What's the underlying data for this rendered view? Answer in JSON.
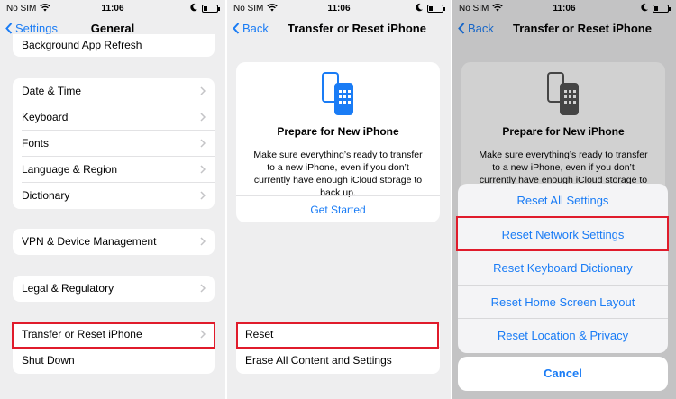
{
  "status": {
    "carrier": "No SIM",
    "time": "11:06"
  },
  "colors": {
    "accent": "#1a7cf5",
    "highlight": "#e01b2b",
    "background": "#eeeeef"
  },
  "panel1": {
    "back_label": "Settings",
    "title": "General",
    "top_item": "Background App Refresh",
    "group_a": [
      "Date & Time",
      "Keyboard",
      "Fonts",
      "Language & Region",
      "Dictionary"
    ],
    "group_b": [
      "VPN & Device Management"
    ],
    "group_c": [
      "Legal & Regulatory"
    ],
    "group_d_item": "Transfer or Reset iPhone",
    "group_d_link": "Shut Down"
  },
  "panel2": {
    "back_label": "Back",
    "title": "Transfer or Reset iPhone",
    "card_title": "Prepare for New iPhone",
    "card_desc": "Make sure everything’s ready to transfer to a new iPhone, even if you don’t currently have enough iCloud storage to back up.",
    "card_button": "Get Started",
    "reset_label": "Reset",
    "erase_label": "Erase All Content and Settings"
  },
  "panel3": {
    "back_label": "Back",
    "title": "Transfer or Reset iPhone",
    "card_title": "Prepare for New iPhone",
    "card_desc": "Make sure everything’s ready to transfer to a new iPhone, even if you don’t currently have enough iCloud storage to back up.",
    "options": [
      "Reset All Settings",
      "Reset Network Settings",
      "Reset Keyboard Dictionary",
      "Reset Home Screen Layout",
      "Reset Location & Privacy"
    ],
    "cancel_label": "Cancel"
  }
}
